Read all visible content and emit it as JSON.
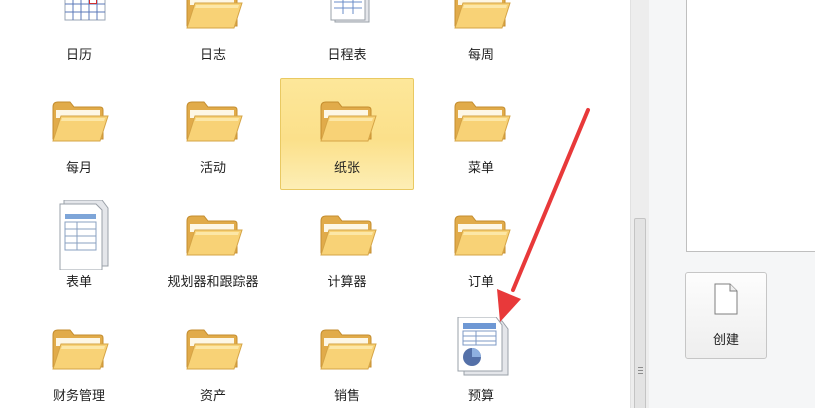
{
  "gallery": {
    "tiles": [
      {
        "label": "日历",
        "icon": "calendar-icon"
      },
      {
        "label": "日志",
        "icon": "folder-icon"
      },
      {
        "label": "日程表",
        "icon": "table-doc-icon"
      },
      {
        "label": "每周",
        "icon": "folder-icon"
      },
      {
        "label": "每月",
        "icon": "folder-icon"
      },
      {
        "label": "活动",
        "icon": "folder-icon"
      },
      {
        "label": "纸张",
        "icon": "folder-icon",
        "selected": true
      },
      {
        "label": "菜单",
        "icon": "folder-icon"
      },
      {
        "label": "表单",
        "icon": "form-doc-icon"
      },
      {
        "label": "规划器和跟踪器",
        "icon": "folder-icon"
      },
      {
        "label": "计算器",
        "icon": "folder-icon"
      },
      {
        "label": "订单",
        "icon": "folder-icon"
      },
      {
        "label": "财务管理",
        "icon": "folder-icon"
      },
      {
        "label": "资产",
        "icon": "folder-icon"
      },
      {
        "label": "销售",
        "icon": "folder-icon"
      },
      {
        "label": "预算",
        "icon": "budget-doc-icon"
      }
    ]
  },
  "right_pane": {
    "create_label": "创建"
  },
  "colors": {
    "selection": "#fbe08a",
    "annotation_arrow": "#e8393a"
  }
}
